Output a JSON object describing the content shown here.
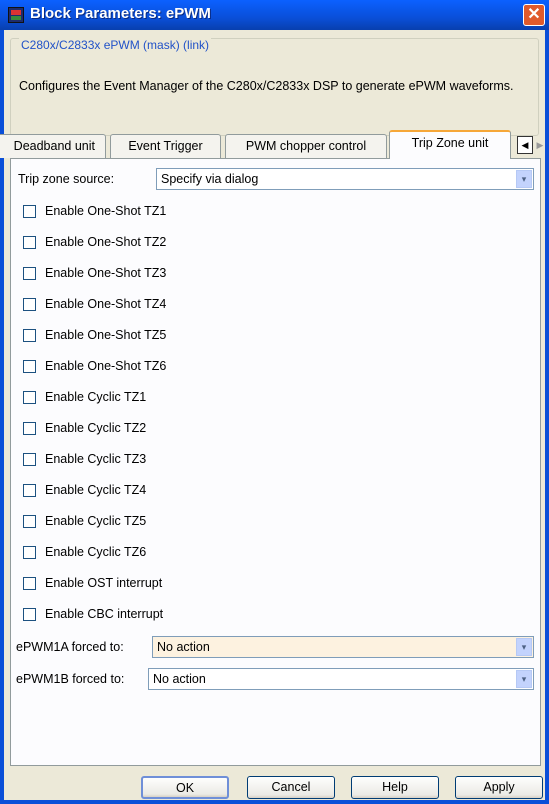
{
  "window": {
    "title": "Block Parameters: ePWM",
    "close": "✕"
  },
  "block": {
    "title": "C280x/C2833x ePWM (mask) (link)",
    "description": "Configures the Event Manager of the C280x/C2833x DSP to generate ePWM waveforms."
  },
  "tabs": {
    "items": [
      {
        "label": "Deadband unit"
      },
      {
        "label": "Event Trigger"
      },
      {
        "label": "PWM chopper control"
      },
      {
        "label": "Trip Zone unit"
      }
    ],
    "scroll_left": "◀",
    "scroll_right": "▶"
  },
  "trip_zone_source": {
    "label": "Trip zone source:",
    "value": "Specify via dialog"
  },
  "checkboxes": [
    {
      "label": "Enable One-Shot TZ1"
    },
    {
      "label": "Enable One-Shot TZ2"
    },
    {
      "label": "Enable One-Shot TZ3"
    },
    {
      "label": "Enable One-Shot TZ4"
    },
    {
      "label": "Enable One-Shot TZ5"
    },
    {
      "label": "Enable One-Shot TZ6"
    },
    {
      "label": "Enable Cyclic TZ1"
    },
    {
      "label": "Enable Cyclic TZ2"
    },
    {
      "label": "Enable Cyclic TZ3"
    },
    {
      "label": "Enable Cyclic TZ4"
    },
    {
      "label": "Enable Cyclic TZ5"
    },
    {
      "label": "Enable Cyclic TZ6"
    },
    {
      "label": "Enable OST interrupt"
    },
    {
      "label": "Enable CBC interrupt"
    }
  ],
  "epwm1a": {
    "label": "ePWM1A forced  to:",
    "value": "No action"
  },
  "epwm1b": {
    "label": "ePWM1B forced  to:",
    "value": "No action"
  },
  "buttons": {
    "ok": "OK",
    "cancel": "Cancel",
    "help": "Help",
    "apply": "Apply"
  },
  "icons": {
    "dropdown": "▾"
  }
}
